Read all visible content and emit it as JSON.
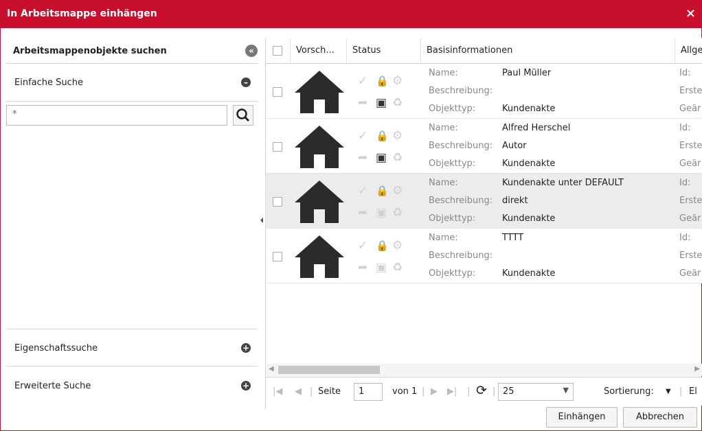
{
  "dialog": {
    "title": "In Arbeitsmappe einhängen",
    "close_label": "×"
  },
  "left": {
    "header": "Arbeitsmappenobjekte suchen",
    "collapse_label": "«",
    "simple": "Einfache Suche",
    "search_value": "*",
    "property": "Eigenschaftssuche",
    "extended": "Erweiterte Suche"
  },
  "grid": {
    "columns": {
      "preview": "Vorsch...",
      "status": "Status",
      "basic": "Basisinformationen",
      "general": "Allge"
    },
    "label_name": "Name:",
    "label_desc": "Beschreibung:",
    "label_type": "Objekttyp:",
    "rows": [
      {
        "name": "Paul Müller",
        "desc": "",
        "type": "Kundenakte",
        "r1": "Id:",
        "r2": "Erste",
        "r3": "Geär"
      },
      {
        "name": "Alfred Herschel",
        "desc": "Autor",
        "type": "Kundenakte",
        "r1": "Id:",
        "r2": "Erste",
        "r3": "Geär"
      },
      {
        "name": "Kundenakte unter DEFAULT",
        "desc": "direkt",
        "type": "Kundenakte",
        "r1": "Id:",
        "r2": "Erste",
        "r3": "Geär"
      },
      {
        "name": "TTTT",
        "desc": "",
        "type": "Kundenakte",
        "r1": "Id:",
        "r2": "Erste",
        "r3": "Geär"
      }
    ]
  },
  "pager": {
    "page_label": "Seite",
    "page_value": "1",
    "of_label": "von 1",
    "page_size": "25",
    "sort_label": "Sortierung:",
    "extra": "El"
  },
  "buttons": {
    "attach": "Einhängen",
    "cancel": "Abbrechen"
  },
  "colors": {
    "accent": "#c8102e"
  }
}
